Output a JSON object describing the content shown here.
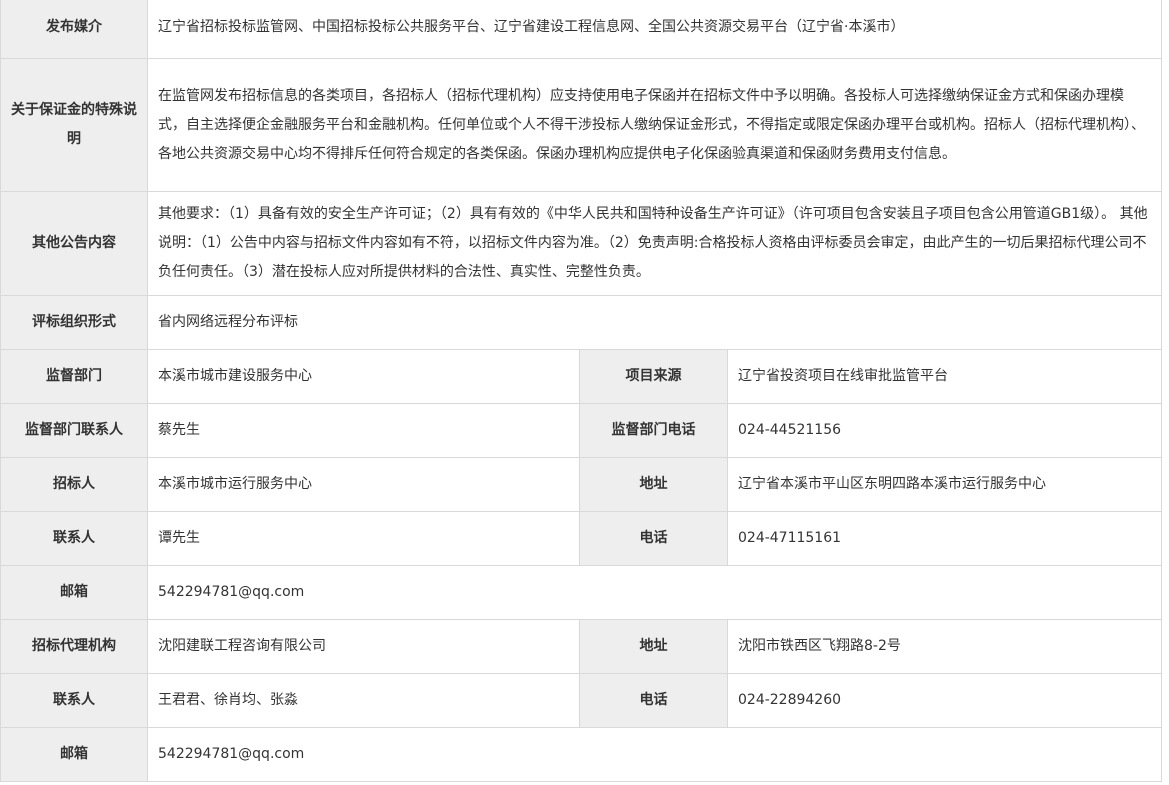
{
  "rows": {
    "media": {
      "label": "发布媒介",
      "value": "辽宁省招标投标监管网、中国招标投标公共服务平台、辽宁省建设工程信息网、全国公共资源交易平台（辽宁省·本溪市）"
    },
    "deposit": {
      "label": "关于保证金的特殊说明",
      "value": "在监管网发布招标信息的各类项目，各招标人（招标代理机构）应支持使用电子保函并在招标文件中予以明确。各投标人可选择缴纳保证金方式和保函办理模式，自主选择便企金融服务平台和金融机构。任何单位或个人不得干涉投标人缴纳保证金形式，不得指定或限定保函办理平台或机构。招标人（招标代理机构）、各地公共资源交易中心均不得排斥任何符合规定的各类保函。保函办理机构应提供电子化保函验真渠道和保函财务费用支付信息。"
    },
    "other": {
      "label": "其他公告内容",
      "value": "其他要求：（1）具备有效的安全生产许可证；（2）具有有效的《中华人民共和国特种设备生产许可证》（许可项目包含安装且子项目包含公用管道GB1级）。 其他说明：（1）公告中内容与招标文件内容如有不符，以招标文件内容为准。（2）免责声明:合格投标人资格由评标委员会审定，由此产生的一切后果招标代理公司不负任何责任。（3）潜在投标人应对所提供材料的合法性、真实性、完整性负责。"
    },
    "evaluation": {
      "label": "评标组织形式",
      "value": "省内网络远程分布评标"
    },
    "supervision": {
      "label": "监督部门",
      "value": "本溪市城市建设服务中心",
      "source_label": "项目来源",
      "source_value": "辽宁省投资项目在线审批监管平台"
    },
    "supervision_contact": {
      "label": "监督部门联系人",
      "value": "蔡先生",
      "phone_label": "监督部门电话",
      "phone_value": "024-44521156"
    },
    "tenderer": {
      "label": "招标人",
      "value": "本溪市城市运行服务中心",
      "address_label": "地址",
      "address_value": "辽宁省本溪市平山区东明四路本溪市运行服务中心"
    },
    "tenderer_contact": {
      "label": "联系人",
      "value": "谭先生",
      "phone_label": "电话",
      "phone_value": "024-47115161"
    },
    "tenderer_email": {
      "label": "邮箱",
      "value": "542294781@qq.com"
    },
    "agency": {
      "label": "招标代理机构",
      "value": "沈阳建联工程咨询有限公司",
      "address_label": "地址",
      "address_value": "沈阳市铁西区飞翔路8-2号"
    },
    "agency_contact": {
      "label": "联系人",
      "value": "王君君、徐肖均、张淼",
      "phone_label": "电话",
      "phone_value": "024-22894260"
    },
    "agency_email": {
      "label": "邮箱",
      "value": "542294781@qq.com"
    }
  },
  "colors": {
    "label_bg": "#eeeeee",
    "border": "#d9d9d9",
    "text": "#333333"
  }
}
